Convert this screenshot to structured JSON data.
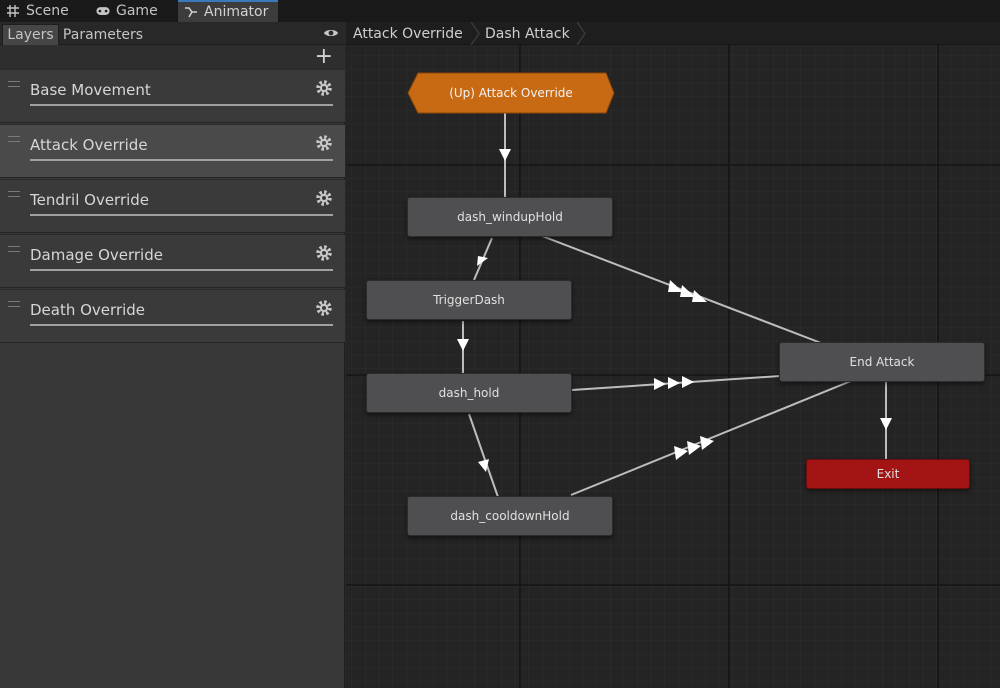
{
  "tabs": [
    {
      "label": "Scene",
      "icon": "grid-icon"
    },
    {
      "label": "Game",
      "icon": "gamepad-icon"
    },
    {
      "label": "Animator",
      "icon": "animator-icon"
    }
  ],
  "left_panel": {
    "subtabs": [
      "Layers",
      "Parameters"
    ],
    "add_label": "+",
    "layers": [
      {
        "name": "Base Movement",
        "weight": 1.0
      },
      {
        "name": "Attack Override",
        "weight": 1.0,
        "selected": true
      },
      {
        "name": "Tendril Override",
        "weight": 1.0
      },
      {
        "name": "Damage Override",
        "weight": 1.0
      },
      {
        "name": "Death Override",
        "weight": 1.0
      }
    ]
  },
  "graph": {
    "breadcrumbs": [
      "Attack Override",
      "Dash Attack"
    ],
    "up_node": "(Up) Attack Override",
    "states": {
      "windup": "dash_windupHold",
      "trigger": "TriggerDash",
      "hold": "dash_hold",
      "cooldown": "dash_cooldownHold",
      "end": "End Attack",
      "exit": "Exit"
    }
  },
  "colors": {
    "accent_tab": "#3a79bb",
    "up_node": "#c86a14",
    "exit_node": "#a31515",
    "state_node": "#4f4f52"
  }
}
